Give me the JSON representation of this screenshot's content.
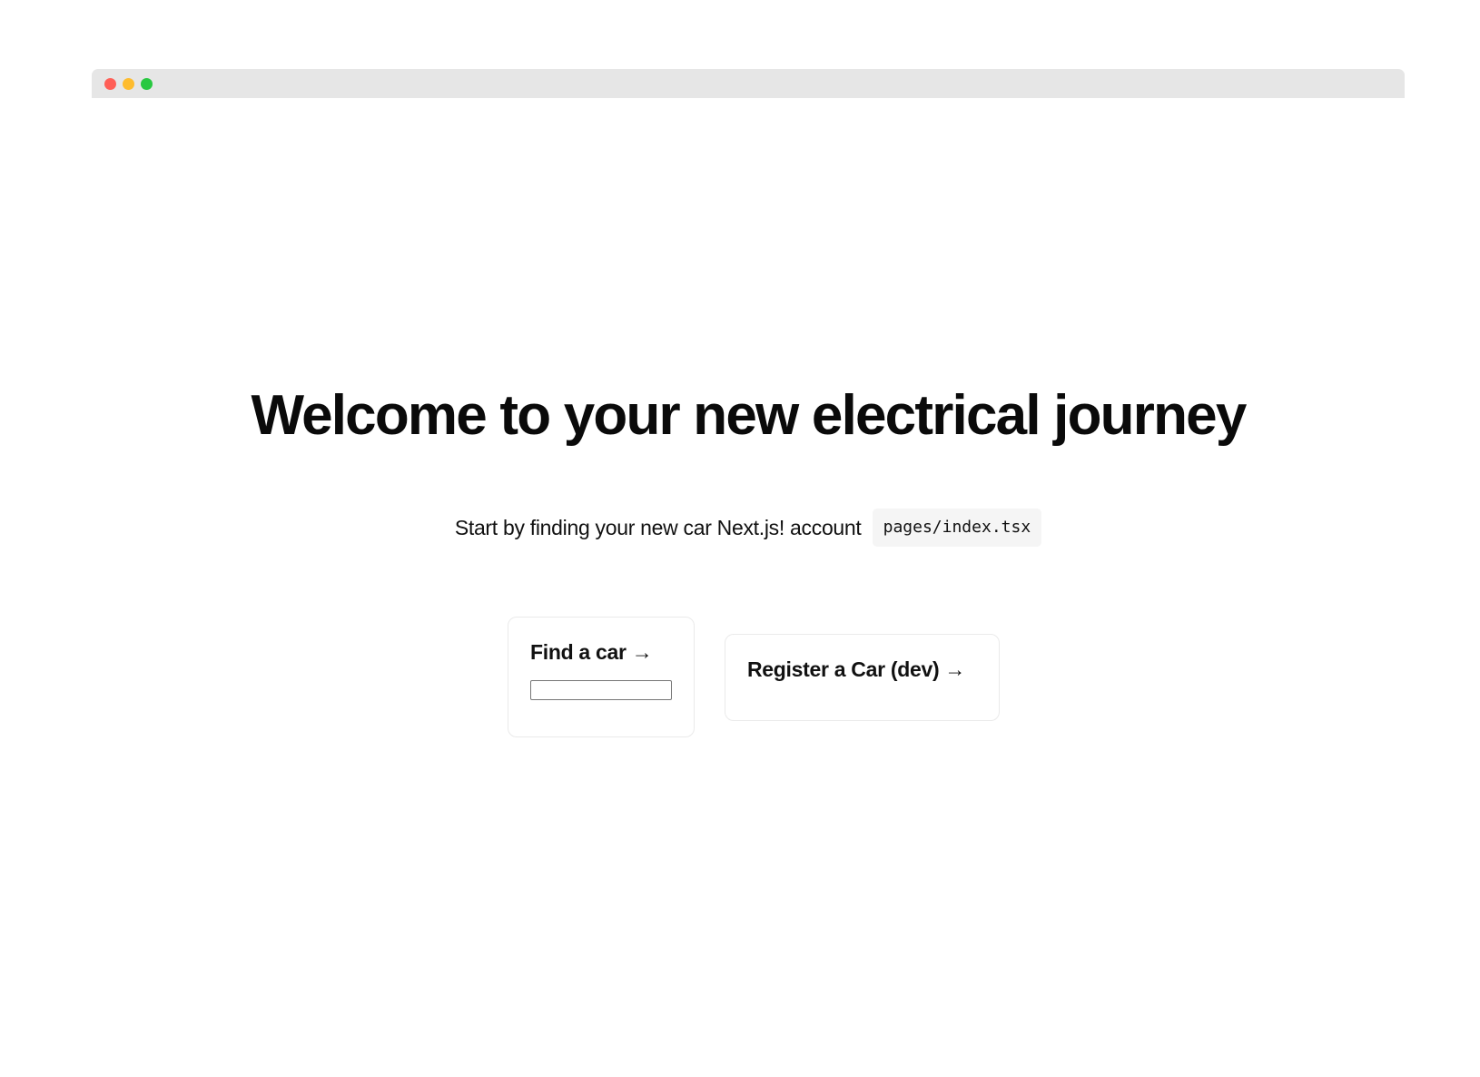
{
  "window": {
    "controls": [
      "close-button",
      "minimize-button",
      "maximize-button"
    ],
    "colors": {
      "close": "#ff5f57",
      "minimize": "#febc2e",
      "maximize": "#28c840",
      "titlebar": "#e6e6e6"
    }
  },
  "main": {
    "title": "Welcome to your new electrical journey",
    "description_text": "Start by finding your new car Next.js! account",
    "code_text": "pages/index.tsx"
  },
  "cards": {
    "find": {
      "heading": "Find a car →",
      "input_value": "",
      "input_placeholder": ""
    },
    "register": {
      "heading": "Register a Car (dev) →"
    }
  }
}
